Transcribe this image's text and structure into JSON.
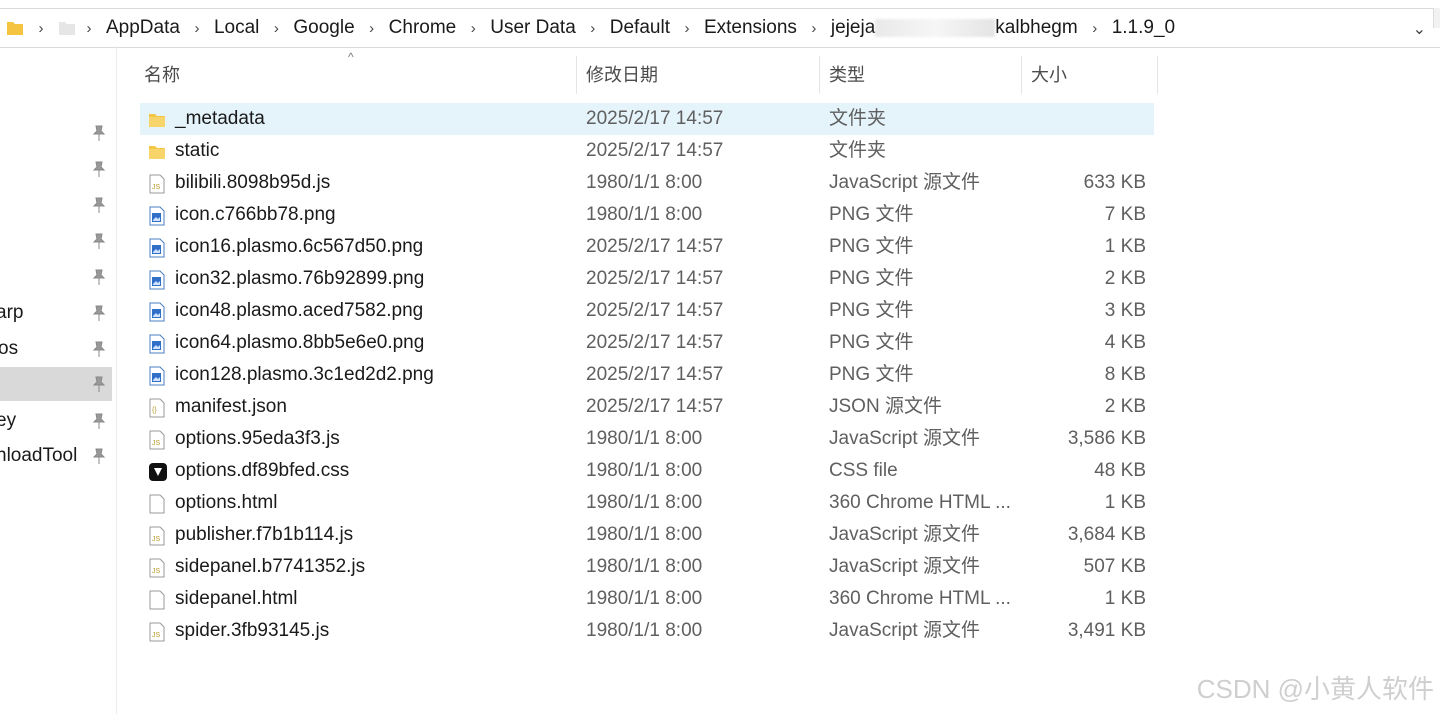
{
  "address_bar": {
    "crumbs": [
      "AppData",
      "Local",
      "Google",
      "Chrome",
      "User Data",
      "Default",
      "Extensions",
      "jejeja",
      "kalbhegm",
      "1.1.9_0"
    ]
  },
  "nav": {
    "items": [
      {
        "label": ""
      },
      {
        "label": ""
      },
      {
        "label": ""
      },
      {
        "label": ""
      },
      {
        "label": ""
      },
      {
        "label": "arp"
      },
      {
        "label": "os"
      },
      {
        "label": ""
      },
      {
        "label": "ey"
      },
      {
        "label": "nloadTool"
      }
    ]
  },
  "columns": {
    "name": "名称",
    "date": "修改日期",
    "type": "类型",
    "size": "大小"
  },
  "files": [
    {
      "name": "_metadata",
      "date": "2025/2/17 14:57",
      "type": "文件夹",
      "size": "",
      "icon": "folder-icon"
    },
    {
      "name": "static",
      "date": "2025/2/17 14:57",
      "type": "文件夹",
      "size": "",
      "icon": "folder-icon"
    },
    {
      "name": "bilibili.8098b95d.js",
      "date": "1980/1/1 8:00",
      "type": "JavaScript 源文件",
      "size": "633 KB",
      "icon": "js-file-icon"
    },
    {
      "name": "icon.c766bb78.png",
      "date": "1980/1/1 8:00",
      "type": "PNG 文件",
      "size": "7 KB",
      "icon": "image-file-icon"
    },
    {
      "name": "icon16.plasmo.6c567d50.png",
      "date": "2025/2/17 14:57",
      "type": "PNG 文件",
      "size": "1 KB",
      "icon": "image-file-icon"
    },
    {
      "name": "icon32.plasmo.76b92899.png",
      "date": "2025/2/17 14:57",
      "type": "PNG 文件",
      "size": "2 KB",
      "icon": "image-file-icon"
    },
    {
      "name": "icon48.plasmo.aced7582.png",
      "date": "2025/2/17 14:57",
      "type": "PNG 文件",
      "size": "3 KB",
      "icon": "image-file-icon"
    },
    {
      "name": "icon64.plasmo.8bb5e6e0.png",
      "date": "2025/2/17 14:57",
      "type": "PNG 文件",
      "size": "4 KB",
      "icon": "image-file-icon"
    },
    {
      "name": "icon128.plasmo.3c1ed2d2.png",
      "date": "2025/2/17 14:57",
      "type": "PNG 文件",
      "size": "8 KB",
      "icon": "image-file-icon"
    },
    {
      "name": "manifest.json",
      "date": "2025/2/17 14:57",
      "type": "JSON 源文件",
      "size": "2 KB",
      "icon": "json-file-icon"
    },
    {
      "name": "options.95eda3f3.js",
      "date": "1980/1/1 8:00",
      "type": "JavaScript 源文件",
      "size": "3,586 KB",
      "icon": "js-file-icon"
    },
    {
      "name": "options.df89bfed.css",
      "date": "1980/1/1 8:00",
      "type": "CSS file",
      "size": "48 KB",
      "icon": "css-file-icon"
    },
    {
      "name": "options.html",
      "date": "1980/1/1 8:00",
      "type": "360 Chrome HTML ...",
      "size": "1 KB",
      "icon": "html-file-icon"
    },
    {
      "name": "publisher.f7b1b114.js",
      "date": "1980/1/1 8:00",
      "type": "JavaScript 源文件",
      "size": "3,684 KB",
      "icon": "js-file-icon"
    },
    {
      "name": "sidepanel.b7741352.js",
      "date": "1980/1/1 8:00",
      "type": "JavaScript 源文件",
      "size": "507 KB",
      "icon": "js-file-icon"
    },
    {
      "name": "sidepanel.html",
      "date": "1980/1/1 8:00",
      "type": "360 Chrome HTML ...",
      "size": "1 KB",
      "icon": "html-file-icon"
    },
    {
      "name": "spider.3fb93145.js",
      "date": "1980/1/1 8:00",
      "type": "JavaScript 源文件",
      "size": "3,491 KB",
      "icon": "js-file-icon"
    }
  ],
  "watermark": "CSDN @小黄人软件"
}
